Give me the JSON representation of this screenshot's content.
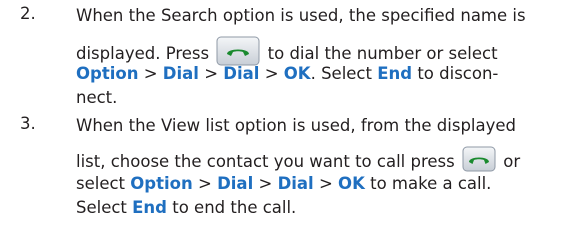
{
  "steps": [
    {
      "number": "2.",
      "line1": "When the Search option is used, the specified name is",
      "line2_pre": "displayed. Press",
      "line2_post": "to dial the number or select",
      "kw_option": "Option",
      "sep1": ">",
      "kw_dial1": "Dial",
      "sep2": ">",
      "kw_dial2": "Dial",
      "sep3": ">",
      "kw_ok": "OK",
      "line3_mid": ". Select",
      "kw_end": "End",
      "line3_post": "to discon-",
      "line4": "nect."
    },
    {
      "number": "3.",
      "line1": "When the View list option is used, from the displayed",
      "line2_pre": "list, choose the contact you want to call press",
      "line2_post": "or",
      "line3_pre": "select",
      "kw_option": "Option",
      "sep1": ">",
      "kw_dial1": "Dial",
      "sep2": ">",
      "kw_dial2": "Dial",
      "sep3": ">",
      "kw_ok": "OK",
      "line3_post": "to make a call.",
      "line4_pre": "Select",
      "kw_end": "End",
      "line4_post": "to end the call."
    }
  ],
  "icons": {
    "call_button": "call-button-icon"
  },
  "colors": {
    "keyword": "#1f6fc0",
    "call_handset": "#1a8a2e"
  }
}
